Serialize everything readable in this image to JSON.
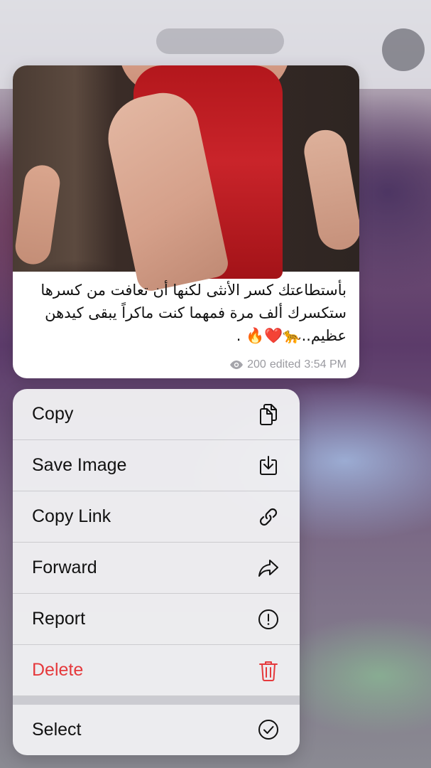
{
  "message": {
    "caption": "بأستطاعتك كسر الأنثى لكنها أن تعافت من كسرها ستكسرك ألف مرة فمهما كنت ماكراً يبقى كيدهن عظيم..🐆❤️🔥 .",
    "views": "200",
    "status": "edited",
    "time": "3:54 PM"
  },
  "menu": {
    "items": [
      {
        "label": "Copy",
        "icon": "copy-icon"
      },
      {
        "label": "Save Image",
        "icon": "save-image-icon"
      },
      {
        "label": "Copy Link",
        "icon": "link-icon"
      },
      {
        "label": "Forward",
        "icon": "forward-icon"
      },
      {
        "label": "Report",
        "icon": "report-icon"
      },
      {
        "label": "Delete",
        "icon": "trash-icon",
        "color": "#e5393c"
      }
    ],
    "select": {
      "label": "Select",
      "icon": "checkmark-circle-icon"
    }
  },
  "colors": {
    "destructive": "#e5393c",
    "meta_text": "#9a9aa0",
    "menu_background": "#f0f0f2"
  }
}
